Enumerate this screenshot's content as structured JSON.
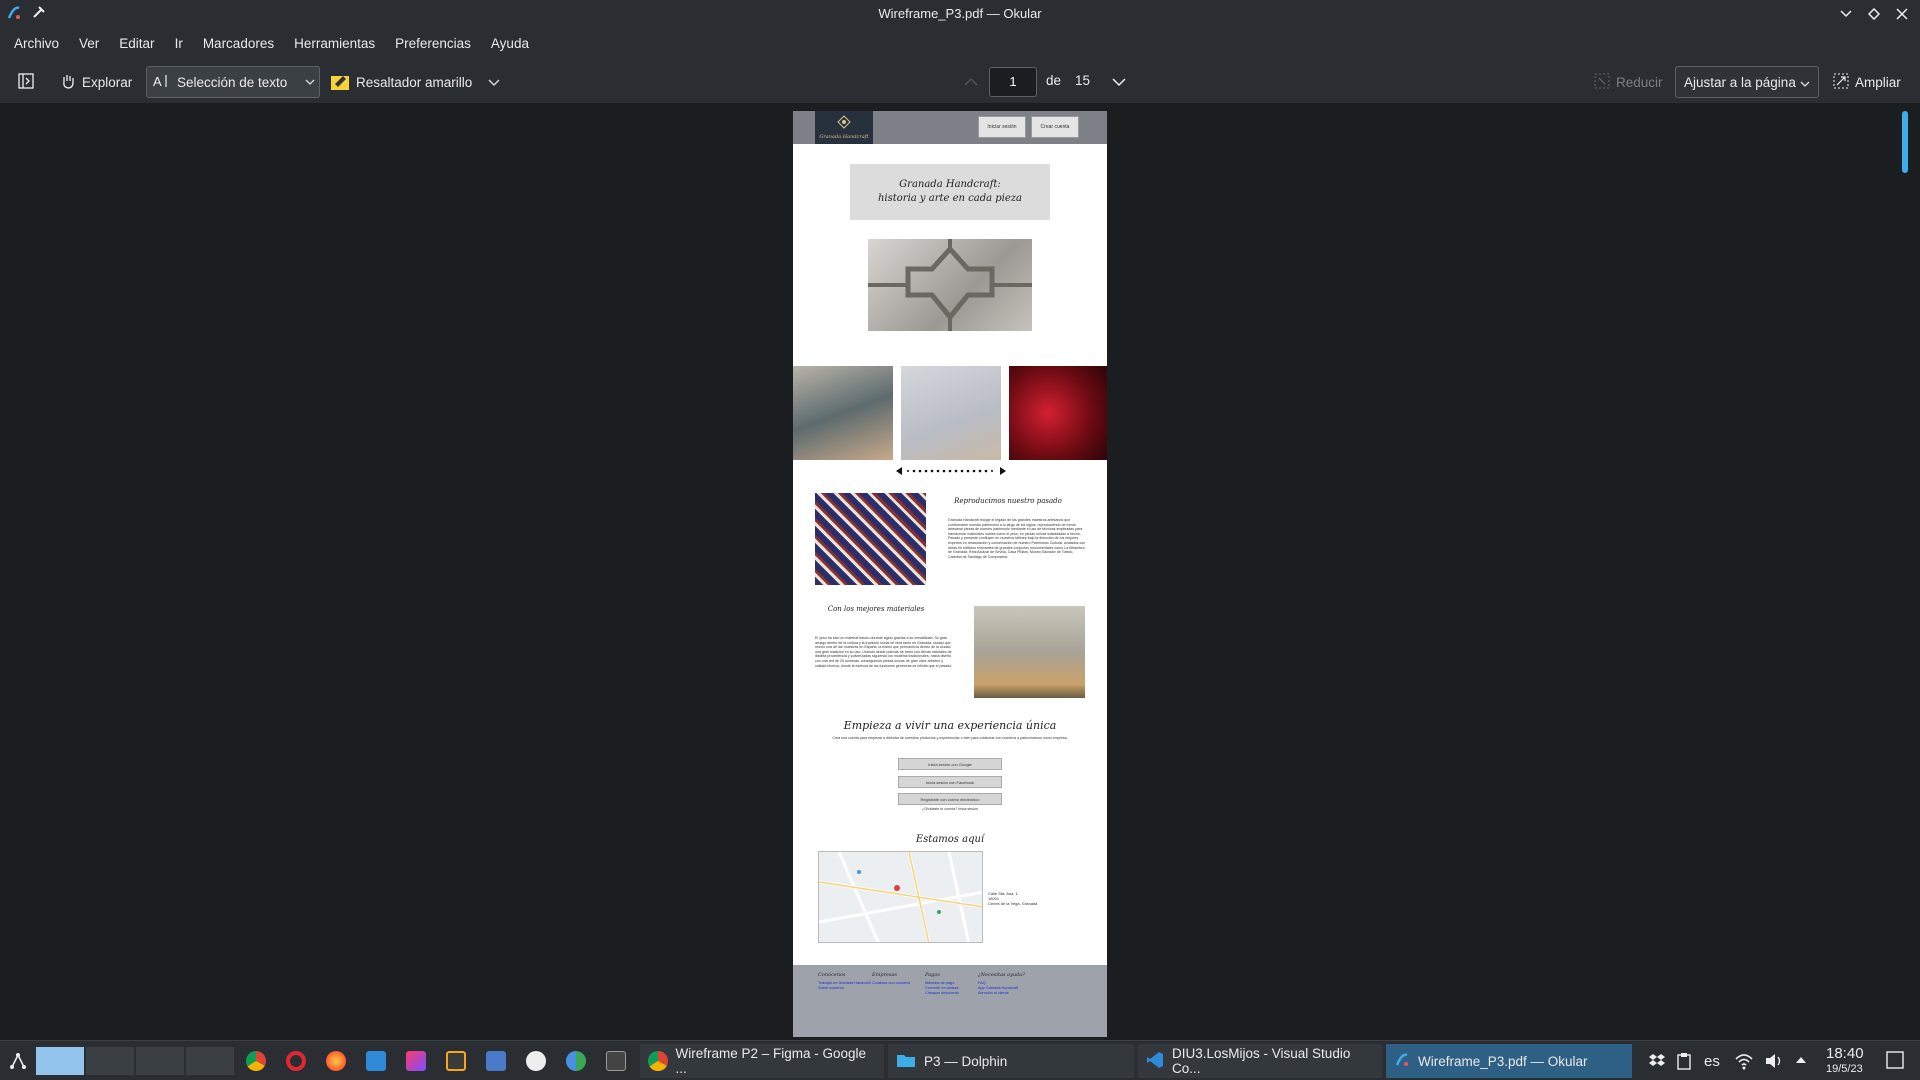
{
  "window": {
    "title": "Wireframe_P3.pdf — Okular"
  },
  "menubar": [
    "Archivo",
    "Ver",
    "Editar",
    "Ir",
    "Marcadores",
    "Herramientas",
    "Preferencias",
    "Ayuda"
  ],
  "toolbar": {
    "browse_label": "Explorar",
    "text_select_label": "Selección de texto",
    "highlighter_label": "Resaltador amarillo",
    "page_current": "1",
    "page_of": "de",
    "page_total": "15",
    "zoom_out_label": "Reducir",
    "zoom_mode": "Ajustar a la página",
    "zoom_in_label": "Ampliar"
  },
  "document": {
    "logo_text": "Granada Handcraft",
    "login_btn": "Iniciar sesión",
    "signup_btn": "Crear cuenta",
    "hero_line1": "Granada Handcraft:",
    "hero_line2": "historia y arte en cada pieza",
    "section1_title": "Reproducimos nuestro pasado",
    "section1_text": "Granada Handcraft recoge el legado de los grandes maestros artesanos que conformaron nuestro patrimonio a lo largo de los siglos, reproduciendo de forma artesanal piezas de nuestro patrimonio mediante el uso de técnicas empleadas para transformar materiales nobles como el yeso, en piezas únicas trasladadas a hecho. Pasado y presente confluyen en nuestros talleres bajo la dirección de los mejores expertos en restauración y conservación de nuestro Patrimonio Cultural, avalados con obras en edificios relevantes de grandes conjuntos monumentales como La Alhambra de Granada, Real Alcázar de Sevilla, Casa Pilatos, Museo Salvador de Toledo, Catedral de Santiago de Compostela.",
    "section2_title": "Con los mejores materiales",
    "section2_text": "El yeso ha sido un material básico durante siglos gracias a su versatilidad. Su gran arraigo dentro de la cultura y la tradición social se verá tanto en Granada, ciudad que reunió una de las muestras en España, la fusión que permanecía dentro de la ciudad una gran tradición en su uso. Usando desde policías de barro con tierras naturales de distinta procedencia y pulverizadas siguiendo los modelos tradicionales, hasta diseño con una red de 20 sombras, conseguimos piezas únicas de gran valor artístico y calidad técnica, donde la esencia de las funciones genéricas es infinita que el pasado.",
    "cta_title": "Empieza a vivir una experiencia única",
    "cta_sub": "Crea una cuenta para empezar a disfrutar de nuestros productos y experiencias o bien para colaborar con nosotros a patrocinarnos como empresa.",
    "auth_google": "Inicia sesión con Google",
    "auth_facebook": "Inicia sesión con Facebook",
    "auth_email": "Regístrate con correo electrónico",
    "auth_note": "¿Olvidaste tu cuenta? Inicia sesión",
    "map_title": "Estamos aquí",
    "address_line1": "Calle Sta. Ana, 1",
    "address_line2": "18001",
    "address_line3": "Cenes de la Vega, Granada",
    "footer": [
      {
        "heading": "Conócenos",
        "links": [
          "Trabajar en Granada Handcraft",
          "Sobre nosotros"
        ]
      },
      {
        "heading": "Empresas",
        "links": [
          "Colabora con nosotros"
        ]
      },
      {
        "heading": "Pagos",
        "links": [
          "Métodos de pago",
          "Convertir en divisas",
          "Cheques descuento"
        ]
      },
      {
        "heading": "¿Necesitas ayuda?",
        "links": [
          "FAQ",
          "App Granada Handcraft",
          "Atención al cliente"
        ]
      }
    ]
  },
  "taskbar": {
    "tasks": [
      {
        "label": "Wireframe P2 – Figma - Google ...",
        "icon": "chrome-icon"
      },
      {
        "label": "P3 — Dolphin",
        "icon": "folder-icon"
      },
      {
        "label": "DIU3.LosMijos - Visual Studio Co...",
        "icon": "vscode-icon"
      },
      {
        "label": "Wireframe_P3.pdf — Okular",
        "icon": "okular-icon"
      }
    ],
    "keyboard_layout": "es",
    "clock_time": "18:40",
    "clock_date": "19/5/23"
  },
  "colors": {
    "accent": "#3daee9",
    "panel": "#2a2e32",
    "viewer_bg": "#1b1e20",
    "active_task": "#2e5f85"
  }
}
